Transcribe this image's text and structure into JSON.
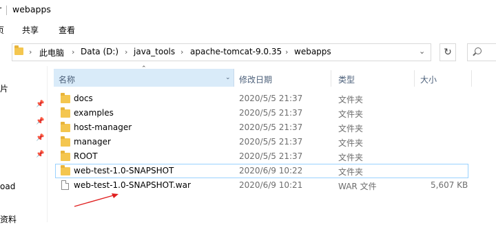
{
  "window": {
    "title": "webapps",
    "title_cut": "r"
  },
  "ribbon": {
    "tabs": [
      "页",
      "共享",
      "查看"
    ]
  },
  "address": {
    "crumbs": [
      "此电脑",
      "Data (D:)",
      "java_tools",
      "apache-tomcat-9.0.35",
      "webapps"
    ],
    "dropdown_icon": "chevron-down-icon",
    "refresh_icon": "refresh-icon",
    "search_icon": "search-icon"
  },
  "nav": {
    "cut_items": [
      "片",
      "oad",
      "资料"
    ]
  },
  "columns": {
    "name": "名称",
    "modified": "修改日期",
    "type": "类型",
    "size": "大小"
  },
  "files": [
    {
      "name": "docs",
      "modified": "2020/5/5 21:37",
      "type": "文件夹",
      "size": "",
      "kind": "folder"
    },
    {
      "name": "examples",
      "modified": "2020/5/5 21:37",
      "type": "文件夹",
      "size": "",
      "kind": "folder"
    },
    {
      "name": "host-manager",
      "modified": "2020/5/5 21:37",
      "type": "文件夹",
      "size": "",
      "kind": "folder"
    },
    {
      "name": "manager",
      "modified": "2020/5/5 21:37",
      "type": "文件夹",
      "size": "",
      "kind": "folder"
    },
    {
      "name": "ROOT",
      "modified": "2020/5/5 21:37",
      "type": "文件夹",
      "size": "",
      "kind": "folder"
    },
    {
      "name": "web-test-1.0-SNAPSHOT",
      "modified": "2020/6/9 10:22",
      "type": "文件夹",
      "size": "",
      "kind": "folder",
      "selected": true
    },
    {
      "name": "web-test-1.0-SNAPSHOT.war",
      "modified": "2020/6/9 10:21",
      "type": "WAR 文件",
      "size": "5,607 KB",
      "kind": "file"
    }
  ],
  "colors": {
    "header_bg": "#d9ebf9",
    "selection_border": "#99d1ff",
    "annotation_arrow": "#e02020",
    "folder": "#f4c64f"
  }
}
